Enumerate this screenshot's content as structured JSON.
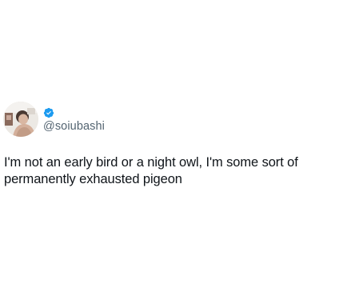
{
  "author": {
    "display_name": "",
    "handle": "@soiubashi",
    "verified": true,
    "verified_color": "#1d9bf0",
    "avatar_icon": "profile-photo"
  },
  "tweet": {
    "text": "I'm not an early bird or a night owl, I'm some sort of permanently exhausted pigeon"
  },
  "colors": {
    "background": "#ffffff",
    "text": "#0f1419",
    "secondary_text": "#536471"
  }
}
